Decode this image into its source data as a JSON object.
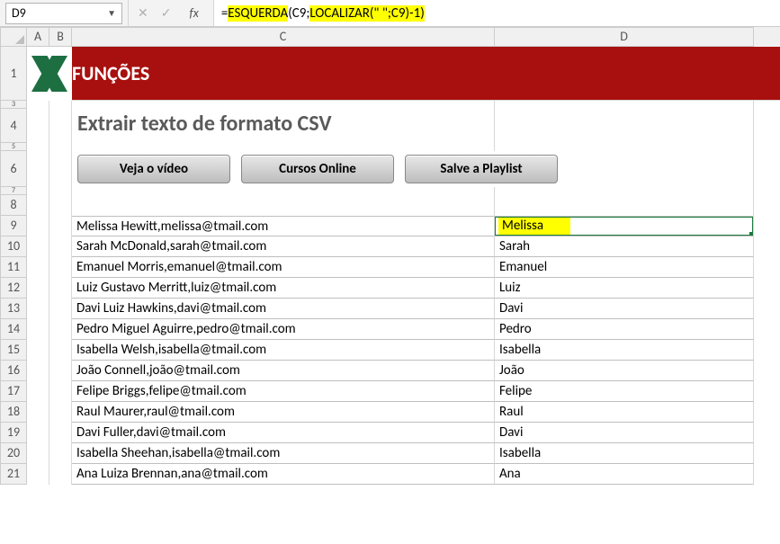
{
  "formula_bar": {
    "cell_ref": "D9",
    "formula_plain": "=ESQUERDA(C9;LOCALIZAR(\" \";C9)-1)",
    "seg1": "=",
    "seg2": "ESQUERDA",
    "seg3": "(C9;",
    "seg4": "LOCALIZAR",
    "seg5": "(\" \";C9)-1)"
  },
  "columns": {
    "A": "A",
    "B": "B",
    "C": "C",
    "D": "D"
  },
  "banner": {
    "title": "FUNÇÕES"
  },
  "section": {
    "title": "Extrair texto de formato CSV"
  },
  "buttons": {
    "video": "Veja o vídeo",
    "cursos": "Cursos Online",
    "playlist": "Salve a Playlist"
  },
  "rows": [
    {
      "n": 9,
      "c": "Melissa Hewitt,melissa@tmail.com",
      "d": "Melissa",
      "selected": true
    },
    {
      "n": 10,
      "c": "Sarah McDonald,sarah@tmail.com",
      "d": "Sarah"
    },
    {
      "n": 11,
      "c": "Emanuel Morris,emanuel@tmail.com",
      "d": "Emanuel"
    },
    {
      "n": 12,
      "c": "Luiz Gustavo Merritt,luiz@tmail.com",
      "d": "Luiz"
    },
    {
      "n": 13,
      "c": "Davi Luiz Hawkins,davi@tmail.com",
      "d": "Davi"
    },
    {
      "n": 14,
      "c": "Pedro Miguel Aguirre,pedro@tmail.com",
      "d": "Pedro"
    },
    {
      "n": 15,
      "c": "Isabella Welsh,isabella@tmail.com",
      "d": "Isabella"
    },
    {
      "n": 16,
      "c": "João Connell,joão@tmail.com",
      "d": "João"
    },
    {
      "n": 17,
      "c": "Felipe Briggs,felipe@tmail.com",
      "d": "Felipe"
    },
    {
      "n": 18,
      "c": "Raul Maurer,raul@tmail.com",
      "d": "Raul"
    },
    {
      "n": 19,
      "c": "Davi Fuller,davi@tmail.com",
      "d": "Davi"
    },
    {
      "n": 20,
      "c": "Isabella Sheehan,isabella@tmail.com",
      "d": "Isabella"
    },
    {
      "n": 21,
      "c": "Ana Luiza Brennan,ana@tmail.com",
      "d": "Ana"
    }
  ]
}
